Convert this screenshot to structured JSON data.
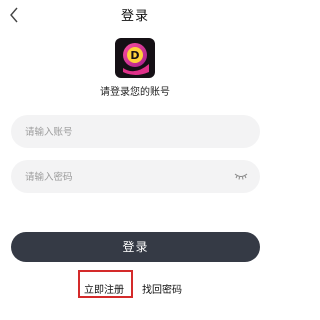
{
  "header": {
    "title": "登录",
    "back_icon": "chevron-left-icon"
  },
  "logo": {
    "icon": "app-logo",
    "letter": "D"
  },
  "subtitle": "请登录您的账号",
  "form": {
    "account_placeholder": "请输入账号",
    "account_value": "",
    "password_placeholder": "请输入密码",
    "password_value": "",
    "password_toggle_icon": "eye-closed-icon"
  },
  "login_button": "登录",
  "links": {
    "register": "立即注册",
    "forgot_password": "找回密码"
  },
  "colors": {
    "button": "#353a45",
    "field_bg": "#f3f3f4",
    "highlight": "#d42a2a"
  }
}
